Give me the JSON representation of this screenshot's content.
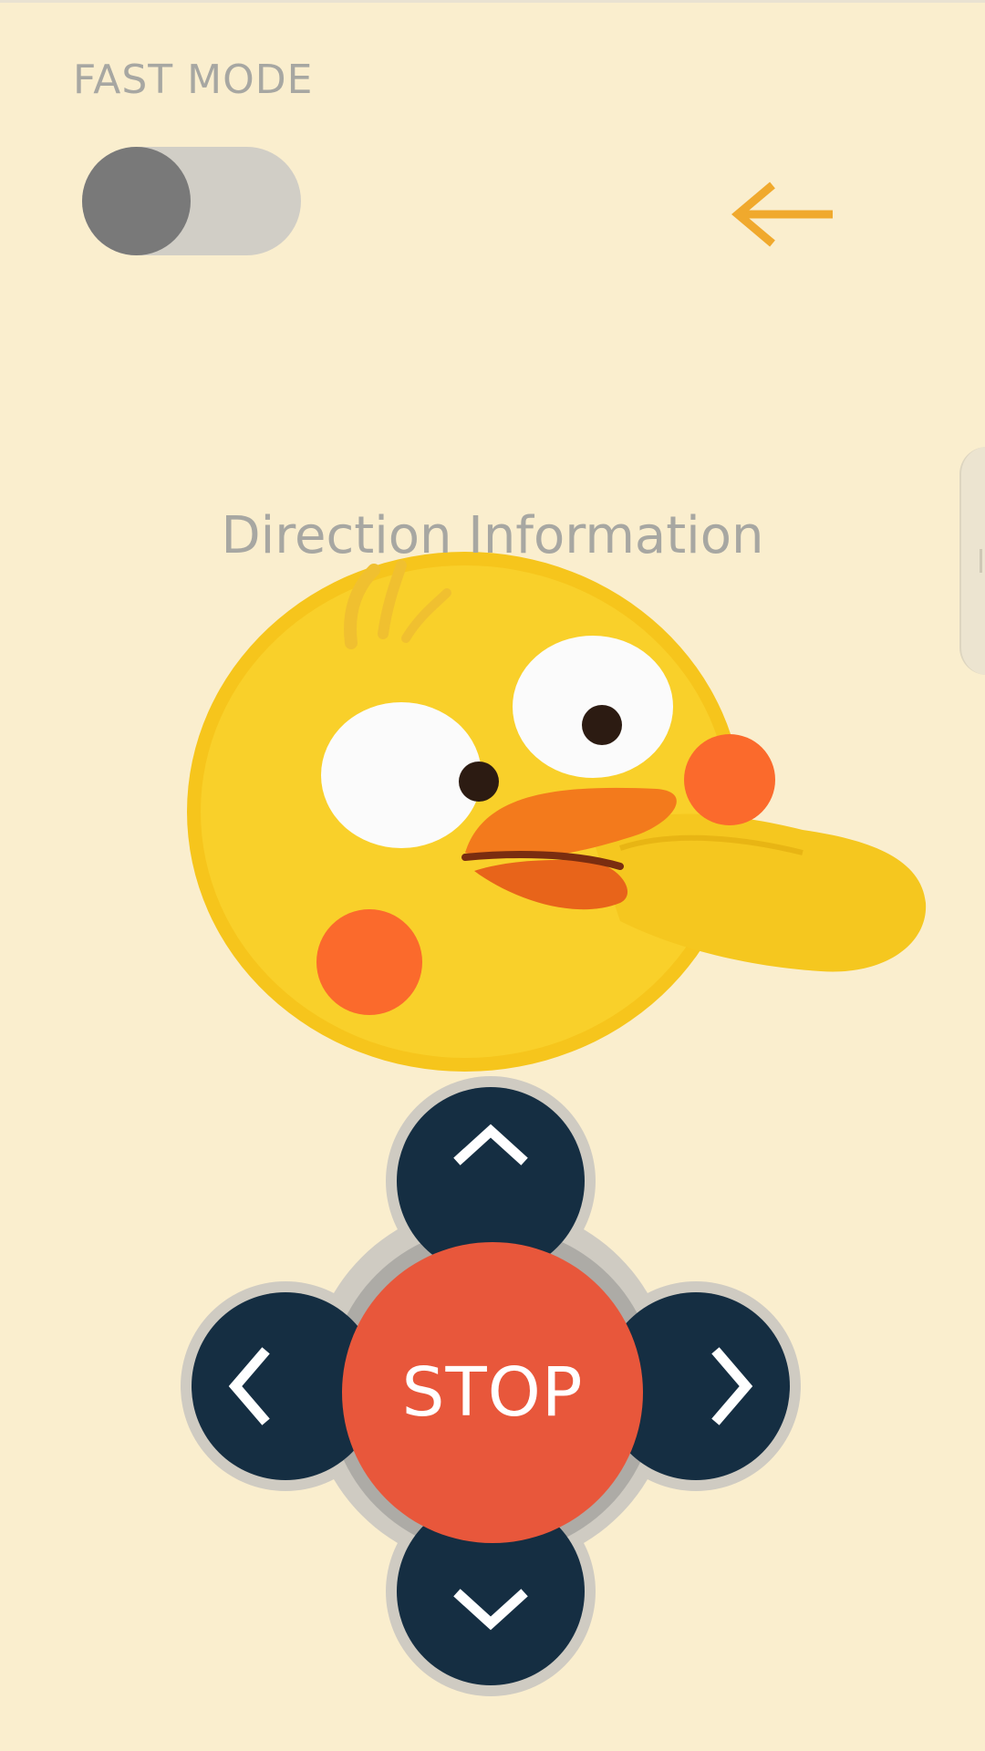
{
  "header": {
    "fast_mode_label": "FAST MODE",
    "fast_mode_toggle_on": false,
    "back_icon": "arrow-left-icon"
  },
  "main": {
    "direction_label": "Direction Information",
    "mascot": "chick-illustration"
  },
  "dpad": {
    "up_icon": "chevron-up-icon",
    "down_icon": "chevron-down-icon",
    "left_icon": "chevron-left-icon",
    "right_icon": "chevron-right-icon",
    "stop_label": "STOP"
  },
  "colors": {
    "background": "#faeece",
    "accent_arrow": "#f0a92d",
    "dpad_button": "#152e42",
    "stop_button": "#e8573b",
    "label_gray": "#a7a7a2"
  }
}
